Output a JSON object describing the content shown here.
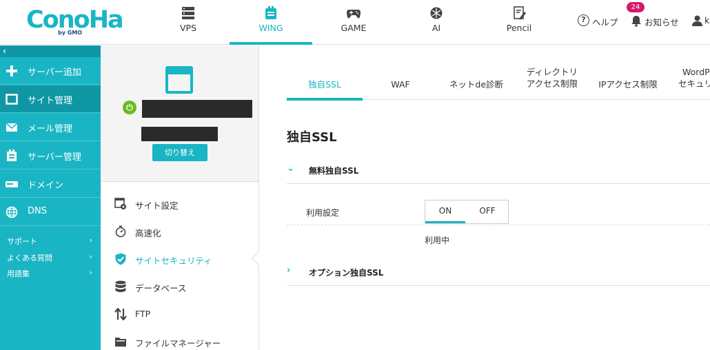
{
  "header": {
    "logo": "ConoHa",
    "logo_sub": "by GMO",
    "nav": [
      {
        "label": "VPS",
        "icon": "server-icon"
      },
      {
        "label": "WING",
        "icon": "wing-icon",
        "active": true
      },
      {
        "label": "GAME",
        "icon": "gamepad-icon"
      },
      {
        "label": "AI",
        "icon": "ai-icon"
      },
      {
        "label": "Pencil",
        "icon": "pencil-icon"
      }
    ],
    "help_label": "ヘルプ",
    "notice_label": "お知らせ",
    "notice_count": "24",
    "user_label": "k"
  },
  "sidebar": {
    "collapse": "‹",
    "items": [
      {
        "label": "サーバー追加",
        "icon": "plus-icon"
      },
      {
        "label": "サイト管理",
        "icon": "window-icon",
        "active": true
      },
      {
        "label": "メール管理",
        "icon": "mail-icon"
      },
      {
        "label": "サーバー管理",
        "icon": "server-manage-icon"
      },
      {
        "label": "ドメイン",
        "icon": "domain-icon"
      },
      {
        "label": "DNS",
        "icon": "globe-icon"
      }
    ],
    "links": [
      {
        "label": "サポート"
      },
      {
        "label": "よくある質問"
      },
      {
        "label": "用語集"
      }
    ]
  },
  "site_panel": {
    "switch_label": "切り替え",
    "menu": [
      {
        "label": "サイト設定",
        "icon": "site-settings-icon"
      },
      {
        "label": "高速化",
        "icon": "stopwatch-icon"
      },
      {
        "label": "サイトセキュリティ",
        "icon": "shield-icon",
        "active": true
      },
      {
        "label": "データベース",
        "icon": "database-icon"
      },
      {
        "label": "FTP",
        "icon": "transfer-icon"
      },
      {
        "label": "ファイルマネージャー",
        "icon": "folder-icon"
      }
    ]
  },
  "content": {
    "tabs": [
      {
        "label": "独自SSL",
        "active": true
      },
      {
        "label": "WAF"
      },
      {
        "label": "ネットde診断"
      },
      {
        "label1": "ディレクトリ",
        "label2": "アクセス制限"
      },
      {
        "label": "IPアクセス制限"
      },
      {
        "label1": "WordPr",
        "label2": "セキュリ"
      }
    ],
    "section_title": "独自SSL",
    "free_ssl": {
      "title": "無料独自SSL",
      "setting_label": "利用設定",
      "on_label": "ON",
      "off_label": "OFF",
      "selected": "ON",
      "status": "利用中"
    },
    "option_ssl": {
      "title": "オプション独自SSL"
    }
  },
  "colors": {
    "accent": "#1ab5c4",
    "sidebar_active": "#1097a5",
    "badge": "#d6176c",
    "power": "#66bb1f"
  }
}
